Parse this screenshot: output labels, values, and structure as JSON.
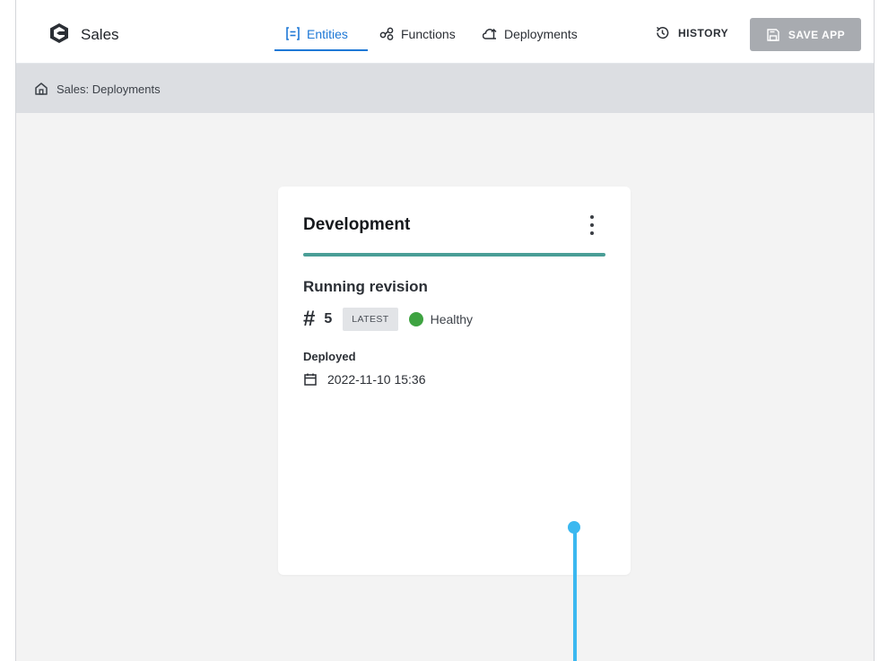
{
  "header": {
    "app_name": "Sales",
    "nav": [
      {
        "label": "Entities",
        "icon": "entities-icon",
        "active": true
      },
      {
        "label": "Functions",
        "icon": "functions-icon",
        "active": false
      },
      {
        "label": "Deployments",
        "icon": "deployments-icon",
        "active": false
      }
    ],
    "history_label": "HISTORY",
    "save_label": "SAVE APP"
  },
  "breadcrumb": {
    "text": "Sales: Deployments",
    "icon": "home-icon"
  },
  "card": {
    "title": "Development",
    "section_title": "Running revision",
    "revision_hash": "#",
    "revision_number": "5",
    "badge": "LATEST",
    "status": "Healthy",
    "status_color": "#3ea341",
    "deployed_label": "Deployed",
    "deployed_at": "2022-11-10 15:36"
  },
  "colors": {
    "accent": "#1e78d6",
    "environment_bar": "#4a9e96",
    "pointer": "#3bb8f0"
  }
}
